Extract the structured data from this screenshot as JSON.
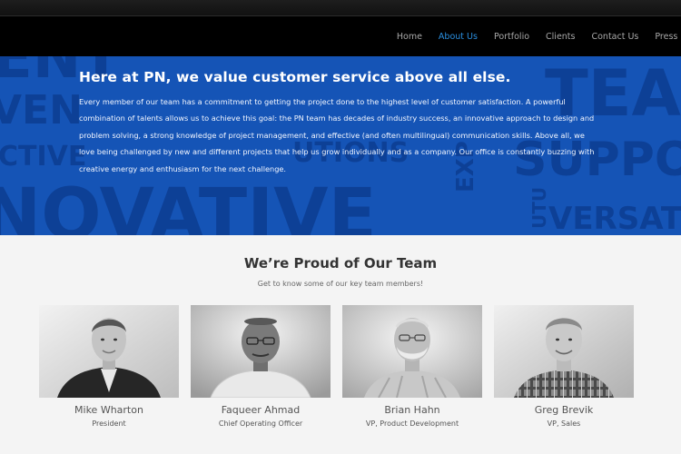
{
  "nav": {
    "items": [
      "Home",
      "About Us",
      "Portfolio",
      "Clients",
      "Contact Us",
      "Press R"
    ],
    "active_index": 1
  },
  "hero": {
    "title": "Here at PN, we value customer service above all else.",
    "text": "Every member of our team has a commitment to getting the project done to the highest level of customer satisfaction. A powerful combination of talents allows us to achieve this goal: the PN team has decades of industry success, an innovative approach to design and problem solving, a strong knowledge of project management, and effective (and often multilingual) communication skills. Above all, we love being challenged by new and different projects that help us grow individually and as a company. Our office is constantly buzzing with creative energy and enthusiasm for the next challenge.",
    "background_words": [
      "ENT",
      "VEN",
      "CTIVE",
      "NOVATIVE",
      "UTIONS",
      "TEA",
      "SUPPO",
      "VERSAT",
      "EXP",
      "UTU"
    ]
  },
  "team": {
    "title": "We’re Proud of Our Team",
    "subtitle": "Get to know some of our key team members!",
    "members": [
      {
        "name": "Mike Wharton",
        "role": "President"
      },
      {
        "name": "Faqueer Ahmad",
        "role": "Chief Operating Officer"
      },
      {
        "name": "Brian Hahn",
        "role": "VP, Product Development"
      },
      {
        "name": "Greg Brevik",
        "role": "VP, Sales"
      }
    ]
  },
  "colors": {
    "hero_blue": "#1554b6",
    "hero_word": "#0d3f95",
    "nav_active": "#2a8fe0",
    "nav_text": "#a9a9a9"
  }
}
